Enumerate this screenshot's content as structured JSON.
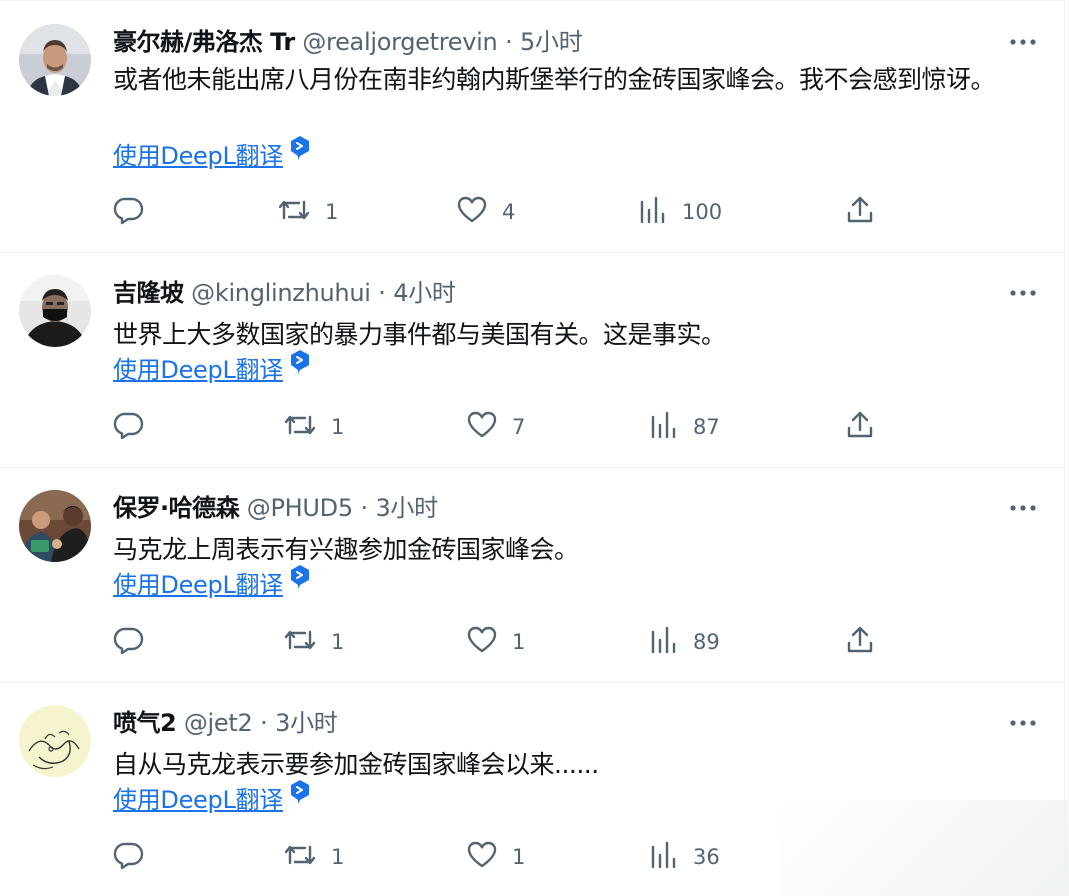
{
  "tweets": [
    {
      "name": "豪尔赫/弗洛杰 Tr",
      "handle": "@realjorgetrevin",
      "separator": "·",
      "time": "5小时",
      "text": "或者他未能出席八月份在南非约翰内斯堡举行的金砖国家峰会。我不会感到惊讶。",
      "translate": "使用DeepL翻译",
      "avatar": "man-in-suit-photo",
      "replies": "",
      "retweets": "1",
      "likes": "4",
      "views": "100"
    },
    {
      "name": "吉隆坡",
      "handle": "@kinglinzhuhui",
      "separator": "·",
      "time": "4小时",
      "text": "世界上大多数国家的暴力事件都与美国有关。这是事实。",
      "translate": "使用DeepL翻译",
      "avatar": "masked-person-photo",
      "replies": "",
      "retweets": "1",
      "likes": "7",
      "views": "87"
    },
    {
      "name": "保罗·哈德森",
      "handle": "@PHUD5",
      "separator": "·",
      "time": "3小时",
      "text": "马克龙上周表示有兴趣参加金砖国家峰会。",
      "translate": "使用DeepL翻译",
      "avatar": "group-photo",
      "replies": "",
      "retweets": "1",
      "likes": "1",
      "views": "89"
    },
    {
      "name": "喷气2",
      "handle": "@jet2",
      "separator": "·",
      "time": "3小时",
      "text": "自从马克龙表示要参加金砖国家峰会以来......",
      "translate": "使用DeepL翻译",
      "avatar": "line-drawing",
      "replies": "",
      "retweets": "1",
      "likes": "1",
      "views": "36"
    }
  ],
  "icons": {
    "reply": "reply-icon",
    "retweet": "retweet-icon",
    "like": "heart-icon",
    "views": "views-icon",
    "share": "share-icon",
    "more": "more-icon",
    "deepl": "deepl-icon"
  },
  "colors": {
    "text": "#0f1419",
    "secondary": "#536471",
    "link": "#1a73e8",
    "divider": "#eff3f4"
  }
}
